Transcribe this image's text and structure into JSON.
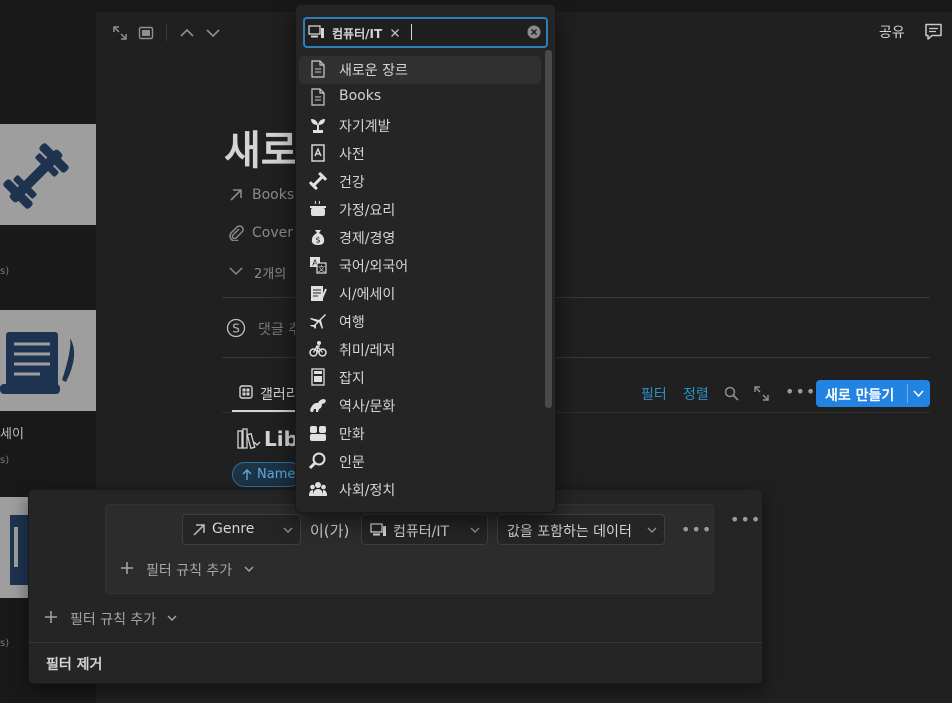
{
  "background_cards": {
    "label_1": "세이",
    "meta": "s)"
  },
  "header": {
    "share_label": "공유"
  },
  "page": {
    "title": "새로",
    "props": [
      {
        "icon": "arrow-ne-icon",
        "label": "Books"
      },
      {
        "icon": "paperclip-icon",
        "label": "Cover"
      }
    ],
    "more_props": "2개의",
    "comment_placeholder": "댓글 추"
  },
  "database": {
    "tab_label": "갤러리",
    "title": "Lib",
    "sort_pill": "Name",
    "toolbar": {
      "filter": "필터",
      "sort": "정렬"
    },
    "new_button": "새로 만들기"
  },
  "filter_popover": {
    "property": "Genre",
    "relation": "이(가)",
    "value": "컴퓨터/IT",
    "condition": "값을 포함하는 데이터",
    "add_rule_inner": "필터 규칙 추가",
    "add_rule_outer": "필터 규칙 추가",
    "remove_filter": "필터 제거"
  },
  "dropdown": {
    "chip_label": "컴퓨터/IT",
    "options": [
      {
        "label": "새로운 장르",
        "icon": "page-icon"
      },
      {
        "label": "Books",
        "icon": "page-icon"
      },
      {
        "label": "자기계발",
        "icon": "sprout-icon"
      },
      {
        "label": "사전",
        "icon": "dictionary-icon"
      },
      {
        "label": "건강",
        "icon": "dumbbell-icon"
      },
      {
        "label": "가정/요리",
        "icon": "cooking-pot-icon"
      },
      {
        "label": "경제/경영",
        "icon": "money-bag-icon"
      },
      {
        "label": "국어/외국어",
        "icon": "translate-icon"
      },
      {
        "label": "시/에세이",
        "icon": "writing-icon"
      },
      {
        "label": "여행",
        "icon": "airplane-icon"
      },
      {
        "label": "취미/레저",
        "icon": "bicycle-icon"
      },
      {
        "label": "잡지",
        "icon": "magazine-icon"
      },
      {
        "label": "역사/문화",
        "icon": "dinosaur-icon"
      },
      {
        "label": "만화",
        "icon": "comic-icon"
      },
      {
        "label": "인문",
        "icon": "magnifier-icon"
      },
      {
        "label": "사회/정치",
        "icon": "people-icon"
      }
    ]
  },
  "colors": {
    "accent": "#2383e2",
    "link": "#2e90c9",
    "panel": "#202020",
    "popover": "#252525"
  }
}
